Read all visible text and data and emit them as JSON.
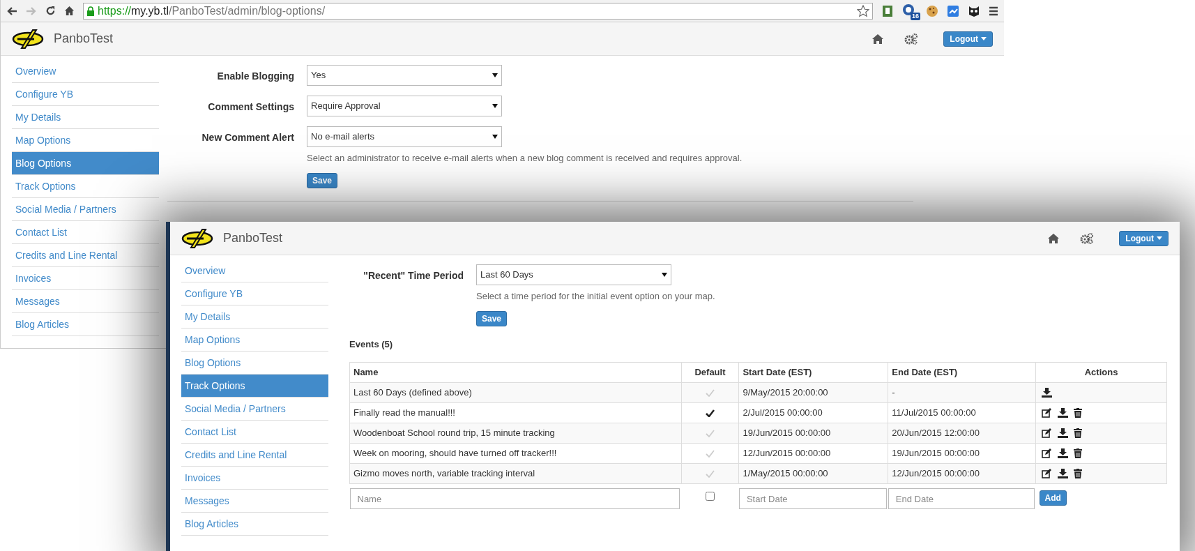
{
  "browser": {
    "url": {
      "scheme": "https://",
      "host": "my.yb.tl",
      "path": "/PanboTest/admin/blog-options/"
    },
    "extension_badge": "16"
  },
  "back_page": {
    "brand": "PanboTest",
    "logout": "Logout",
    "sidebar": [
      {
        "label": "Overview",
        "selected": false
      },
      {
        "label": "Configure YB",
        "selected": false
      },
      {
        "label": "My Details",
        "selected": false
      },
      {
        "label": "Map Options",
        "selected": false
      },
      {
        "label": "Blog Options",
        "selected": true
      },
      {
        "label": "Track Options",
        "selected": false
      },
      {
        "label": "Social Media / Partners",
        "selected": false
      },
      {
        "label": "Contact List",
        "selected": false
      },
      {
        "label": "Credits and Line Rental",
        "selected": false
      },
      {
        "label": "Invoices",
        "selected": false
      },
      {
        "label": "Messages",
        "selected": false
      },
      {
        "label": "Blog Articles",
        "selected": false
      }
    ],
    "fields": [
      {
        "label": "Enable Blogging",
        "value": "Yes"
      },
      {
        "label": "Comment Settings",
        "value": "Require Approval"
      },
      {
        "label": "New Comment Alert",
        "value": "No e-mail alerts",
        "help": "Select an administrator to receive e-mail alerts when a new blog comment is received and requires approval."
      }
    ],
    "save": "Save"
  },
  "front_page": {
    "brand": "PanboTest",
    "logout": "Logout",
    "sidebar": [
      {
        "label": "Overview",
        "selected": false
      },
      {
        "label": "Configure YB",
        "selected": false
      },
      {
        "label": "My Details",
        "selected": false
      },
      {
        "label": "Map Options",
        "selected": false
      },
      {
        "label": "Blog Options",
        "selected": false
      },
      {
        "label": "Track Options",
        "selected": true
      },
      {
        "label": "Social Media / Partners",
        "selected": false
      },
      {
        "label": "Contact List",
        "selected": false
      },
      {
        "label": "Credits and Line Rental",
        "selected": false
      },
      {
        "label": "Invoices",
        "selected": false
      },
      {
        "label": "Messages",
        "selected": false
      },
      {
        "label": "Blog Articles",
        "selected": false
      }
    ],
    "fields": [
      {
        "label": "\"Recent\" Time Period",
        "value": "Last 60 Days",
        "help": "Select a time period for the initial event option on your map."
      }
    ],
    "save": "Save",
    "events_title": "Events (5)",
    "table": {
      "columns": [
        "Name",
        "Default",
        "Start Date (EST)",
        "End Date (EST)",
        "Actions"
      ],
      "rows": [
        {
          "name": "Last 60 Days (defined above)",
          "default": false,
          "start": "9/May/2015 20:00:00",
          "end": "-",
          "actions": {
            "edit": false,
            "download": true,
            "delete": false
          }
        },
        {
          "name": "Finally read the manual!!!",
          "default": true,
          "start": "2/Jul/2015 00:00:00",
          "end": "11/Jul/2015 00:00:00",
          "actions": {
            "edit": true,
            "download": true,
            "delete": true
          }
        },
        {
          "name": "Woodenboat School round trip, 15 minute tracking",
          "default": false,
          "start": "19/Jun/2015 00:00:00",
          "end": "20/Jun/2015 12:00:00",
          "actions": {
            "edit": true,
            "download": true,
            "delete": true
          }
        },
        {
          "name": "Week on mooring, should have turned off tracker!!!",
          "default": false,
          "start": "12/Jun/2015 00:00:00",
          "end": "19/Jun/2015 00:00:00",
          "actions": {
            "edit": true,
            "download": true,
            "delete": true
          }
        },
        {
          "name": "Gizmo moves north, variable tracking interval",
          "default": false,
          "start": "1/May/2015 00:00:00",
          "end": "12/Jun/2015 00:00:00",
          "actions": {
            "edit": true,
            "download": true,
            "delete": true
          }
        }
      ],
      "new_row": {
        "name_placeholder": "Name",
        "default_checked": false,
        "start_placeholder": "Start Date",
        "end_placeholder": "End Date",
        "add": "Add"
      }
    }
  }
}
